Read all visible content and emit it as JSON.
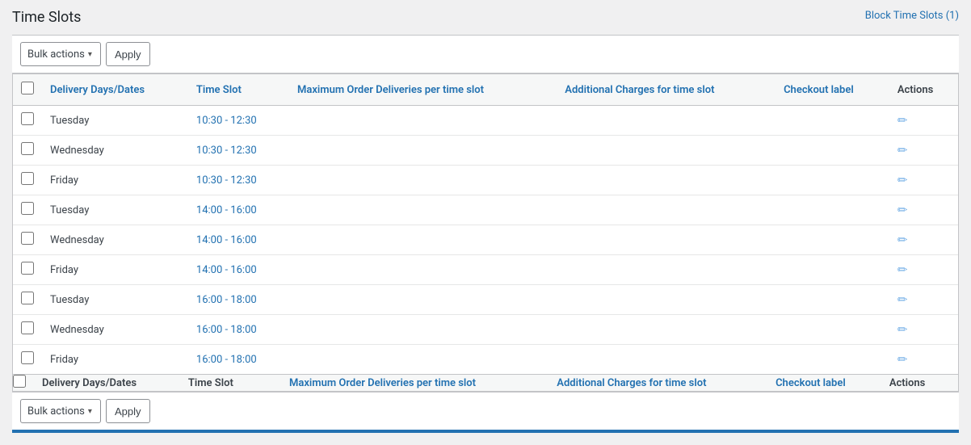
{
  "header": {
    "title": "Time Slots",
    "block_time_link": "Block Time Slots (1)"
  },
  "top_toolbar": {
    "bulk_actions_label": "Bulk actions",
    "apply_label": "Apply"
  },
  "table": {
    "columns": [
      {
        "id": "check",
        "label": ""
      },
      {
        "id": "delivery",
        "label": "Delivery Days/Dates"
      },
      {
        "id": "timeslot",
        "label": "Time Slot"
      },
      {
        "id": "max_order",
        "label": "Maximum Order Deliveries per time slot"
      },
      {
        "id": "additional",
        "label": "Additional Charges for time slot"
      },
      {
        "id": "checkout",
        "label": "Checkout label"
      },
      {
        "id": "actions",
        "label": "Actions"
      }
    ],
    "rows": [
      {
        "day": "Tuesday",
        "time": "10:30 - 12:30",
        "max": "",
        "additional": "",
        "checkout": ""
      },
      {
        "day": "Wednesday",
        "time": "10:30 - 12:30",
        "max": "",
        "additional": "",
        "checkout": ""
      },
      {
        "day": "Friday",
        "time": "10:30 - 12:30",
        "max": "",
        "additional": "",
        "checkout": ""
      },
      {
        "day": "Tuesday",
        "time": "14:00 - 16:00",
        "max": "",
        "additional": "",
        "checkout": ""
      },
      {
        "day": "Wednesday",
        "time": "14:00 - 16:00",
        "max": "",
        "additional": "",
        "checkout": ""
      },
      {
        "day": "Friday",
        "time": "14:00 - 16:00",
        "max": "",
        "additional": "",
        "checkout": ""
      },
      {
        "day": "Tuesday",
        "time": "16:00 - 18:00",
        "max": "",
        "additional": "",
        "checkout": ""
      },
      {
        "day": "Wednesday",
        "time": "16:00 - 18:00",
        "max": "",
        "additional": "",
        "checkout": ""
      },
      {
        "day": "Friday",
        "time": "16:00 - 18:00",
        "max": "",
        "additional": "",
        "checkout": ""
      }
    ],
    "footer_columns": [
      {
        "id": "delivery",
        "label": "Delivery Days/Dates"
      },
      {
        "id": "timeslot",
        "label": "Time Slot"
      },
      {
        "id": "max_order",
        "label": "Maximum Order Deliveries per time slot"
      },
      {
        "id": "additional",
        "label": "Additional Charges for time slot"
      },
      {
        "id": "checkout",
        "label": "Checkout label"
      },
      {
        "id": "actions",
        "label": "Actions"
      }
    ]
  },
  "bottom_toolbar": {
    "bulk_actions_label": "Bulk actions",
    "apply_label": "Apply"
  },
  "icons": {
    "edit": "✏",
    "chevron_down": "▾"
  }
}
